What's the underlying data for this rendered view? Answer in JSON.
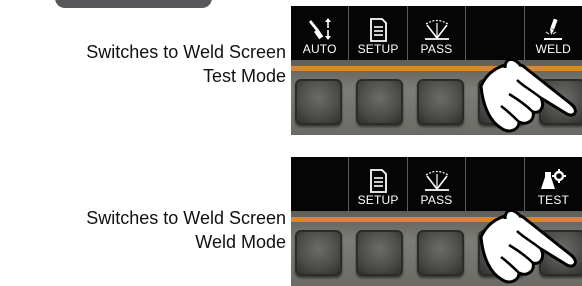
{
  "steps": [
    {
      "caption": [
        "Switches to Weld Screen",
        "Test Mode"
      ],
      "softkeys": [
        {
          "label": "AUTO",
          "icon": "auto-torch-icon"
        },
        {
          "label": "SETUP",
          "icon": "setup-document-icon"
        },
        {
          "label": "PASS",
          "icon": "pass-fan-icon"
        },
        {
          "label": "",
          "icon": ""
        },
        {
          "label": "WELD",
          "icon": "weld-torch-icon"
        }
      ]
    },
    {
      "caption": [
        "Switches to Weld Screen",
        "Weld Mode"
      ],
      "softkeys": [
        {
          "label": "",
          "icon": ""
        },
        {
          "label": "SETUP",
          "icon": "setup-document-icon"
        },
        {
          "label": "PASS",
          "icon": "pass-fan-icon"
        },
        {
          "label": "",
          "icon": ""
        },
        {
          "label": "TEST",
          "icon": "test-flask-gear-icon"
        }
      ]
    }
  ],
  "colors": {
    "softkey_bar": "#050505",
    "accent_stripe": "#d9862c",
    "bezel": "#6c6b66",
    "button": "#4e4f4b"
  }
}
